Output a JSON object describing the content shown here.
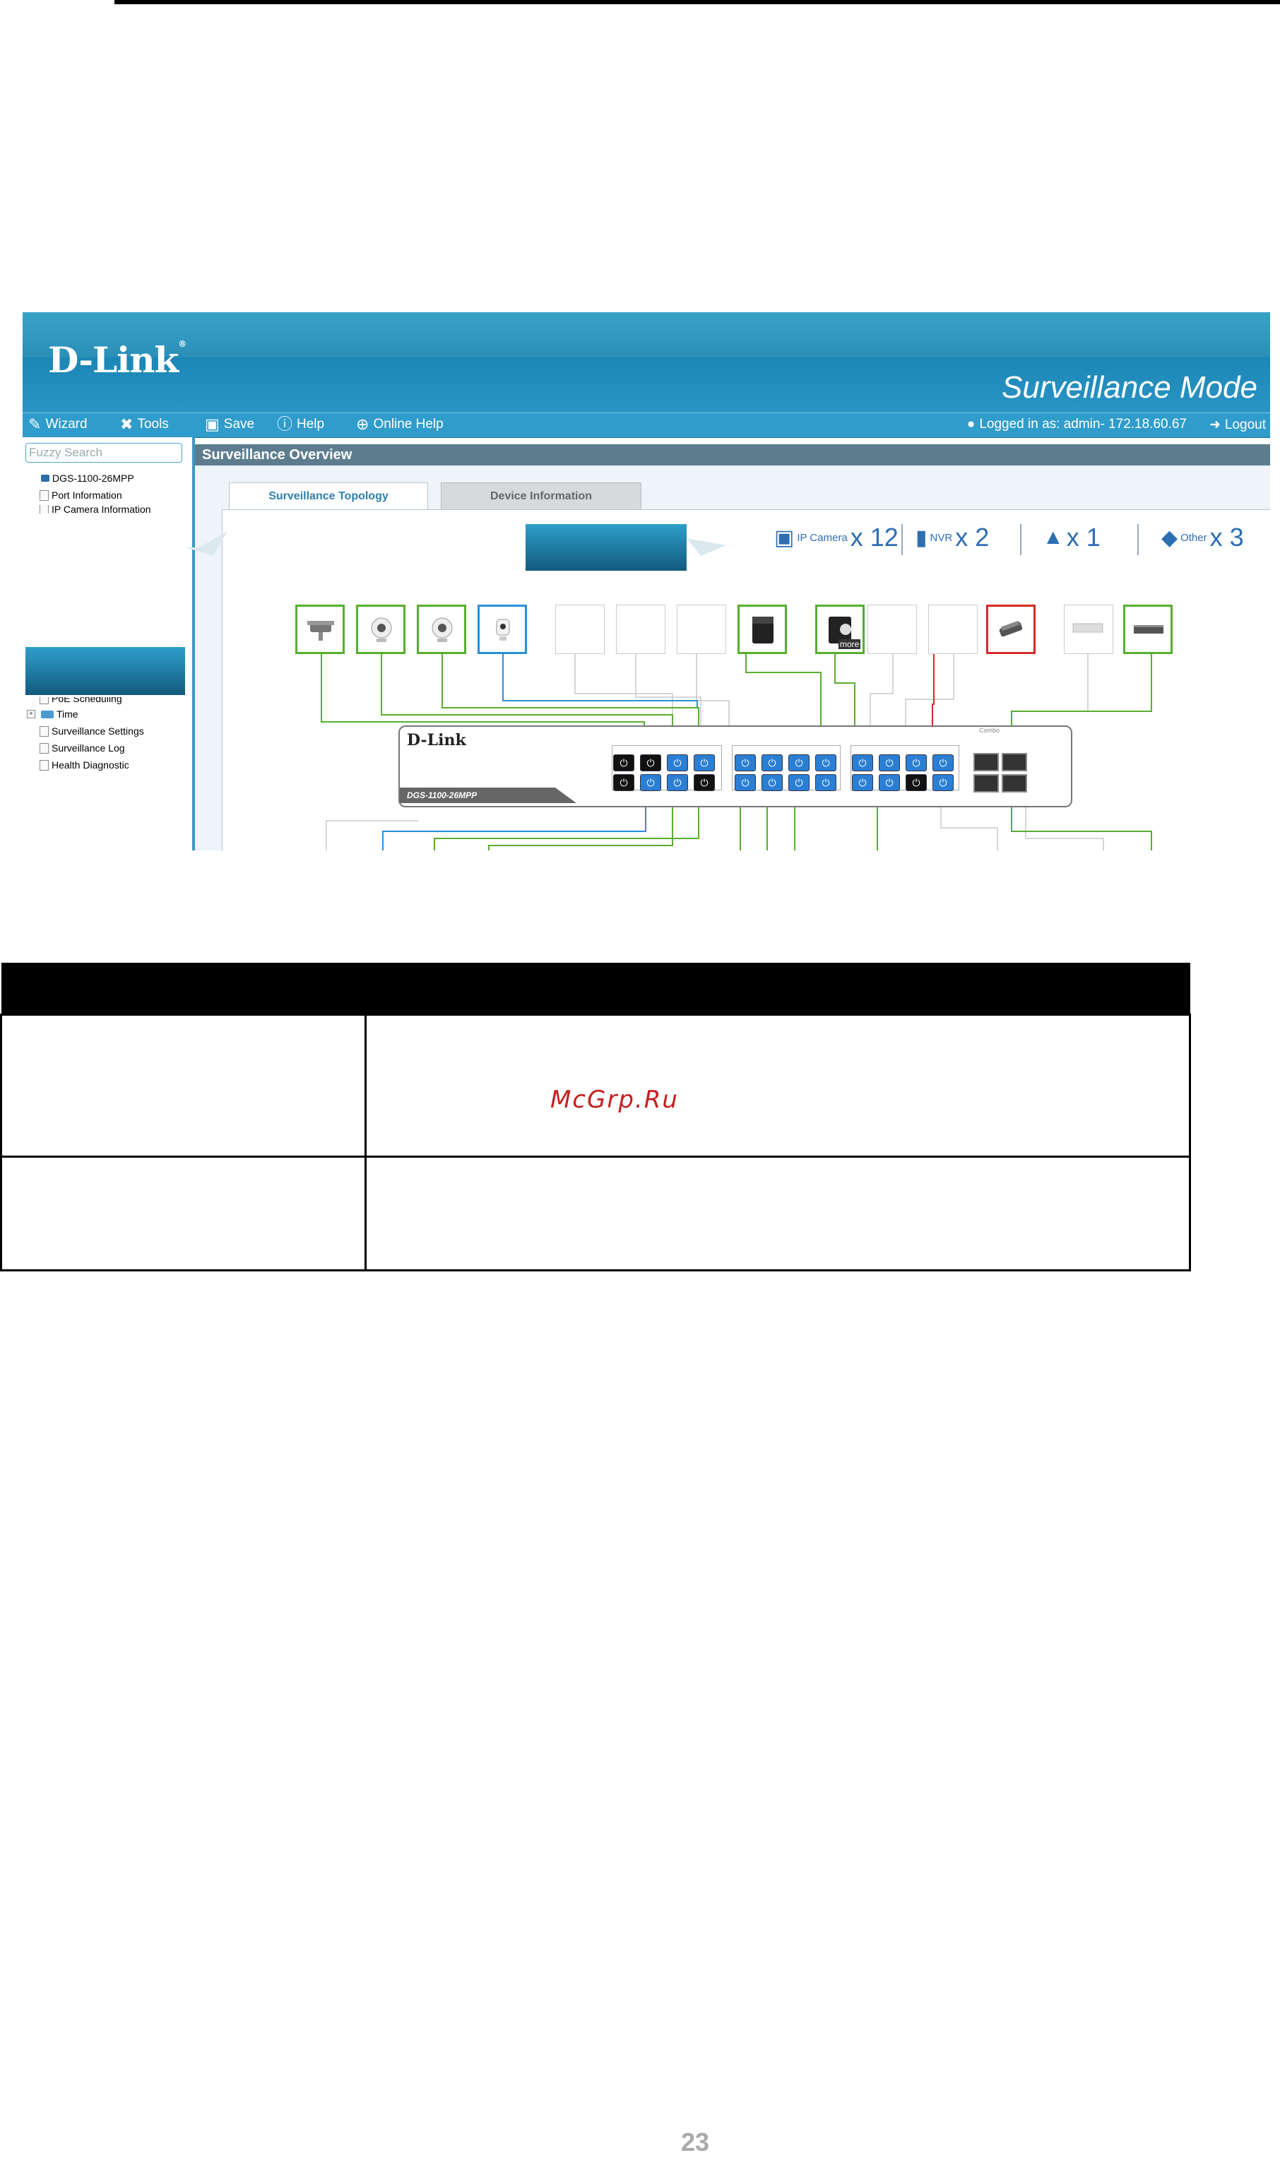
{
  "app": {
    "brand": "D-Link",
    "mode_title": "Surveillance Mode"
  },
  "menu": {
    "wizard": "Wizard",
    "tools": "Tools",
    "save": "Save",
    "help": "Help",
    "online_help": "Online Help",
    "logged_in": "Logged in as: admin- 172.18.60.67",
    "logout": "Logout"
  },
  "sidebar": {
    "search_placeholder": "Fuzzy Search",
    "items": [
      "DGS-1100-26MPP",
      "Port Information",
      "IP Camera Information",
      "PoE Scheduling",
      "Time",
      "Surveillance Settings",
      "Surveillance Log",
      "Health Diagnostic"
    ]
  },
  "main": {
    "title": "Surveillance Overview",
    "tabs": [
      "Surveillance Topology",
      "Device Information"
    ],
    "counts": {
      "ip_camera_label": "IP Camera",
      "ip_camera": "x 12",
      "nvr_label": "NVR",
      "nvr": "x 2",
      "alert": "x 1",
      "other_label": "Other",
      "other": "x 3"
    },
    "switch": {
      "logo": "D-Link",
      "model": "DGS-1100-26MPP",
      "combo_label": "Combo"
    },
    "more_label": "more"
  },
  "table": {
    "watermark": "McGrp.Ru"
  },
  "footer": {
    "page_number": "23"
  },
  "colors": {
    "accent": "#2f9ccb",
    "link_green": "#58ae2f",
    "link_blue": "#2a90d6",
    "alert_red": "#d52a2a",
    "port_blue": "#2a7fd4"
  }
}
